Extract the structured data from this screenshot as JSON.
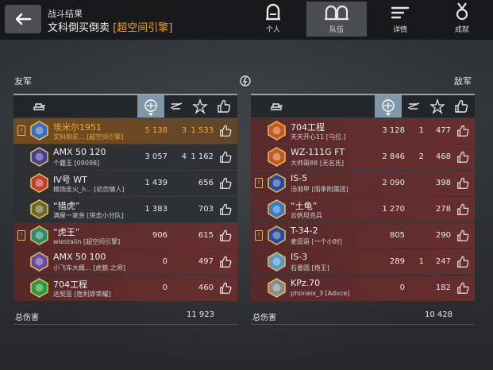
{
  "header": {
    "subtitle": "战斗结果",
    "player_name": "文科倒买倒卖",
    "clan_tag": "[超空间引擎]",
    "tabs": [
      {
        "label": "个人",
        "icon": "helmet-icon"
      },
      {
        "label": "队伍",
        "icon": "team-icon"
      },
      {
        "label": "详情",
        "icon": "list-icon"
      },
      {
        "label": "成就",
        "icon": "medal-icon"
      }
    ],
    "active_tab": "队伍"
  },
  "allies": {
    "label": "友军",
    "total_label": "总伤害",
    "total": "11 923",
    "rows": [
      {
        "name": "埃米尔1951",
        "player": "文科倒买...",
        "clan": "[超空间引擎]",
        "damage": "5 138",
        "kills": "3",
        "assist": "1 533",
        "style": "gold",
        "flag": true,
        "emblem_color": "#3d6db5"
      },
      {
        "name": "AMX 50 120",
        "player": "个霾王",
        "clan": "[09098]",
        "damage": "3 057",
        "kills": "4",
        "assist": "1 162",
        "style": "dark",
        "flag": false,
        "emblem_color": "#4a3f8c"
      },
      {
        "name": "IV号 WT",
        "player": "擦炮走火_h...",
        "clan": "[初恋情人]",
        "damage": "1 439",
        "kills": "",
        "assist": "656",
        "style": "dark",
        "flag": false,
        "emblem_color": "#c04030"
      },
      {
        "name": "“猎虎”",
        "player": "满屋一家亲",
        "clan": "[突击小分队]",
        "damage": "1 383",
        "kills": "",
        "assist": "703",
        "style": "dark",
        "flag": false,
        "emblem_color": "#6a6a2a"
      },
      {
        "name": "“虎王”",
        "player": "wiestalin",
        "clan": "[超空间引擎]",
        "damage": "906",
        "kills": "",
        "assist": "615",
        "style": "red",
        "flag": true,
        "emblem_color": "#2f8a6a"
      },
      {
        "name": "AMX 50 100",
        "player": "小飞车大概...",
        "clan": "[虎狼.之师]",
        "damage": "0",
        "kills": "",
        "assist": "497",
        "style": "red",
        "flag": false,
        "emblem_color": "#6a4a9a"
      },
      {
        "name": "704工程",
        "player": "达契亚",
        "clan": "[胜利即荣耀]",
        "damage": "0",
        "kills": "",
        "assist": "460",
        "style": "red",
        "flag": false,
        "emblem_color": "#2a9a3a"
      }
    ]
  },
  "enemies": {
    "label": "敌军",
    "total_label": "总伤害",
    "total": "10 428",
    "rows": [
      {
        "name": "704工程",
        "player": "天天开心11",
        "clan": "[乌拉.]",
        "damage": "3 128",
        "kills": "1",
        "assist": "477",
        "style": "red",
        "flag": false,
        "emblem_color": "#c05a20"
      },
      {
        "name": "WZ-111G FT",
        "player": "大帅哥88",
        "clan": "[无名氏]",
        "damage": "2 846",
        "kills": "2",
        "assist": "468",
        "style": "red",
        "flag": false,
        "emblem_color": "#c05a20"
      },
      {
        "name": "IS-5",
        "player": "汤湘甲",
        "clan": "[雨季附属团]",
        "damage": "2 090",
        "kills": "",
        "assist": "398",
        "style": "red",
        "flag": true,
        "emblem_color": "#2a4a9a"
      },
      {
        "name": "“土龟”",
        "player": "云帆坦克兵",
        "clan": "",
        "damage": "1 270",
        "kills": "",
        "assist": "278",
        "style": "red",
        "flag": false,
        "emblem_color": "#3a7ac0"
      },
      {
        "name": "T-34-2",
        "player": "麦田哥",
        "clan": "[一个小时]",
        "damage": "805",
        "kills": "",
        "assist": "290",
        "style": "red",
        "flag": true,
        "emblem_color": "#2a4a9a"
      },
      {
        "name": "IS-3",
        "player": "石番圆",
        "clan": "[炮王]",
        "damage": "289",
        "kills": "1",
        "assist": "247",
        "style": "red",
        "flag": false,
        "emblem_color": "#5a9ac0"
      },
      {
        "name": "KPz.70",
        "player": "phoneix_3",
        "clan": "[Advce]",
        "damage": "0",
        "kills": "",
        "assist": "182",
        "style": "red",
        "flag": false,
        "emblem_color": "#8a8a8a"
      }
    ]
  },
  "colors": {
    "accent": "#f2a623",
    "selected_header": "#7f97a8"
  }
}
